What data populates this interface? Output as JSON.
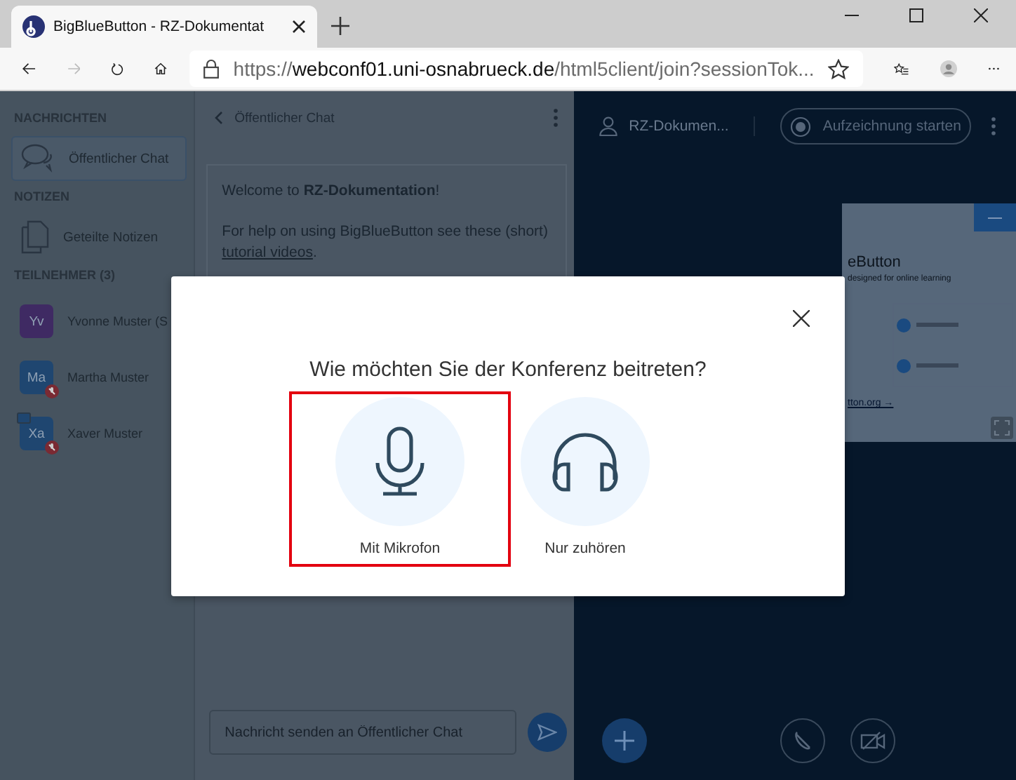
{
  "browser": {
    "tab": {
      "title": "BigBlueButton - RZ-Dokumentat"
    },
    "url": {
      "scheme": "https://",
      "host": "webconf01.uni-osnabrueck.de",
      "path": "/html5client/join?sessionTok..."
    }
  },
  "sidebar": {
    "sections": [
      {
        "heading": "NACHRICHTEN",
        "items": [
          {
            "label": "Öffentlicher Chat",
            "kind": "chat",
            "selected": true
          }
        ]
      },
      {
        "heading": "NOTIZEN",
        "items": [
          {
            "label": "Geteilte Notizen",
            "kind": "notes",
            "selected": false
          }
        ]
      }
    ],
    "participants": {
      "heading": "TEILNEHMER (3)",
      "users": [
        {
          "initials": "Yv",
          "name": "Yvonne Muster (S",
          "color": "#3f2a63",
          "muted": false,
          "presenter": false
        },
        {
          "initials": "Ma",
          "name": "Martha Muster",
          "color": "#1f4670",
          "muted": true,
          "presenter": false
        },
        {
          "initials": "Xa",
          "name": "Xaver Muster",
          "color": "#1f4670",
          "muted": true,
          "presenter": true
        }
      ]
    }
  },
  "chat": {
    "title": "Öffentlicher Chat",
    "welcome": "Welcome to **RZ-Dokumentation**!",
    "help_text": "For help on using BigBlueButton see these (short)",
    "help_link": "tutorial videos",
    "help_end": ".",
    "input": {
      "placeholder": "Nachricht senden an Öffentlicher Chat"
    }
  },
  "presentation": {
    "meeting_name": "RZ-Dokumen...",
    "record_button": "Aufzeichnung starten",
    "slide": {
      "title": "eButton",
      "subtitle": "designed for online learning",
      "link": "tton.org →"
    }
  },
  "modal": {
    "question": "Wie möchten Sie der Konferenz beitreten?",
    "options": [
      {
        "label": "Mit Mikrofon",
        "kind": "microphone",
        "selected": true
      },
      {
        "label": "Nur zuhören",
        "kind": "listen",
        "selected": false
      }
    ]
  }
}
